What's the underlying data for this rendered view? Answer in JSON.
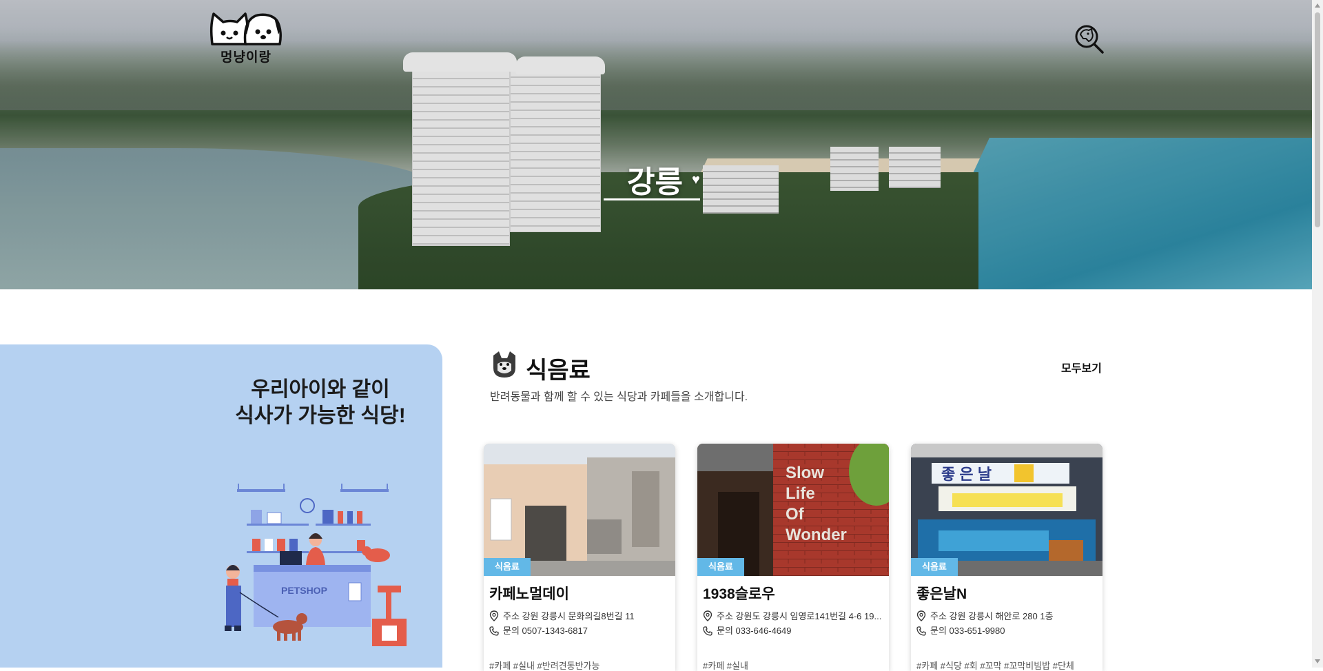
{
  "header": {
    "logo_text": "멍냥이랑",
    "hero_title": "강릉",
    "search_icon": "search-icon"
  },
  "promo": {
    "line1": "우리아이와 같이",
    "line2": "식사가 가능한 식당!",
    "illustration_sign": "PETSHOP"
  },
  "category": {
    "title": "식음료",
    "see_all": "모두보기",
    "description": "반려동물과 함께 할 수 있는 식당과 카페들을 소개합니다."
  },
  "cards": [
    {
      "badge": "식음료",
      "name": "카페노멀데이",
      "address": "주소 강원 강릉시 문화의길8번길 11",
      "phone": "문의 0507-1343-6817",
      "tags": "#카페 #실내 #반려견동반가능"
    },
    {
      "badge": "식음료",
      "name": "1938슬로우",
      "address": "주소 강원도 강릉시 임영로141번길 4-6 19...",
      "phone": "문의 033-646-4649",
      "tags": "#카페 #실내"
    },
    {
      "badge": "식음료",
      "name": "좋은날N",
      "address": "주소 강원 강릉시 해안로 280 1층",
      "phone": "문의 033-651-9980",
      "tags": "#카페 #식당 #회 #꼬막 #꼬막비빔밥 #단체"
    }
  ],
  "colors": {
    "promo_bg": "#b5d1f1",
    "badge_bg": "#62b8e7"
  }
}
